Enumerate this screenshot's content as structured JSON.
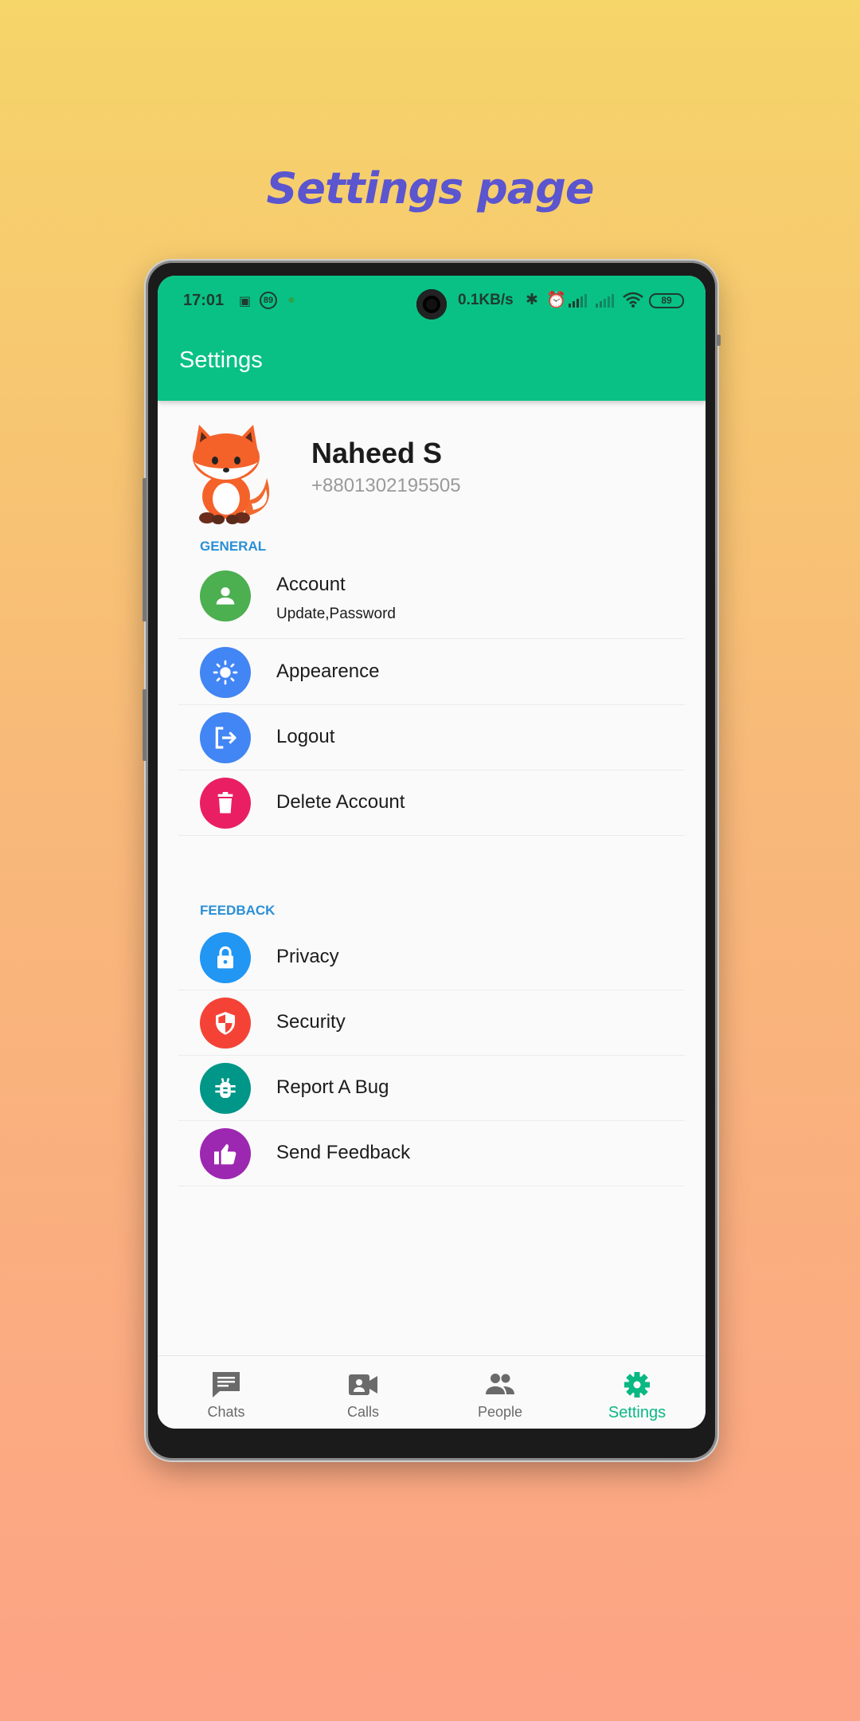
{
  "headline": "Settings page",
  "status_bar": {
    "time": "17:01",
    "notif_badge": "89",
    "net_speed": "0.1KB/s",
    "battery": "89"
  },
  "app_bar": {
    "title": "Settings"
  },
  "profile": {
    "name": "Naheed S",
    "phone": "+8801302195505"
  },
  "sections": {
    "general": {
      "title": "GENERAL",
      "items": [
        {
          "label": "Account",
          "sub": "Update,Password",
          "icon": "person-icon",
          "color": "#4caf50"
        },
        {
          "label": "Appearence",
          "icon": "brightness-icon",
          "color": "#4285f4"
        },
        {
          "label": "Logout",
          "icon": "logout-icon",
          "color": "#4285f4"
        },
        {
          "label": "Delete Account",
          "icon": "delete-icon",
          "color": "#e91e63"
        }
      ]
    },
    "feedback": {
      "title": "FEEDBACK",
      "items": [
        {
          "label": "Privacy",
          "icon": "lock-icon",
          "color": "#2196f3"
        },
        {
          "label": "Security",
          "icon": "shield-icon",
          "color": "#f44336"
        },
        {
          "label": "Report A Bug",
          "icon": "bug-icon",
          "color": "#009688"
        },
        {
          "label": "Send Feedback",
          "icon": "thumbs-up-icon",
          "color": "#9c27b0"
        }
      ]
    }
  },
  "bottom_nav": {
    "items": [
      {
        "label": "Chats",
        "icon": "chat-icon"
      },
      {
        "label": "Calls",
        "icon": "video-call-icon"
      },
      {
        "label": "People",
        "icon": "people-icon"
      },
      {
        "label": "Settings",
        "icon": "gear-icon",
        "active": true
      }
    ]
  },
  "colors": {
    "accent": "#09c184",
    "section_title": "#2a8fd6",
    "headline": "#5b55cf"
  }
}
